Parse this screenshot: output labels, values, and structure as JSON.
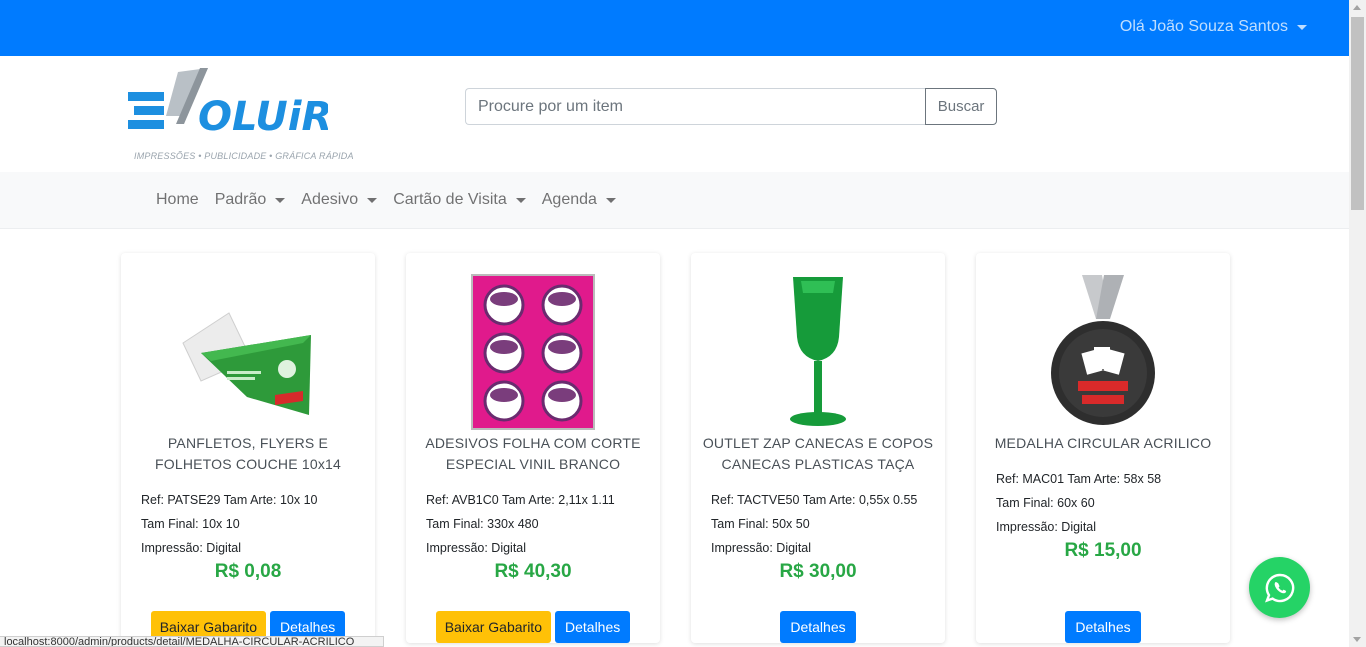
{
  "topbar": {
    "user_greeting": "Olá João Souza Santos"
  },
  "logo": {
    "tagline": "IMPRESSÕES • PUBLICIDADE • GRÁFICA RÁPIDA"
  },
  "search": {
    "placeholder": "Procure por um item",
    "button_label": "Buscar"
  },
  "nav": {
    "items": [
      {
        "label": "Home"
      },
      {
        "label": "Padrão"
      },
      {
        "label": "Adesivo"
      },
      {
        "label": "Cartão de Visita"
      },
      {
        "label": "Agenda"
      }
    ]
  },
  "products": [
    {
      "title": "PANFLETOS, FLYERS E FOLHETOS COUCHE 10x14",
      "ref_line": "Ref: PATSE29 Tam Arte: 10x 10",
      "size_line": "Tam Final: 10x 10",
      "print_line": "Impressão: Digital",
      "price": "R$ 0,08",
      "template_button": "Baixar Gabarito",
      "details_button": "Detalhes"
    },
    {
      "title": "ADESIVOS FOLHA COM CORTE ESPECIAL VINIL BRANCO",
      "ref_line": "Ref: AVB1C0 Tam Arte: 2,11x 1.11",
      "size_line": "Tam Final: 330x 480",
      "print_line": "Impressão: Digital",
      "price": "R$ 40,30",
      "template_button": "Baixar Gabarito",
      "details_button": "Detalhes"
    },
    {
      "title": "OUTLET ZAP CANECAS E COPOS CANECAS PLASTICAS TAÇA",
      "ref_line": "Ref: TACTVE50 Tam Arte: 0,55x 0.55",
      "size_line": "Tam Final: 50x 50",
      "print_line": "Impressão: Digital",
      "price": "R$ 30,00",
      "details_button": "Detalhes"
    },
    {
      "title": "MEDALHA CIRCULAR ACRILICO",
      "ref_line": "Ref: MAC01 Tam Arte: 58x 58",
      "size_line": "Tam Final: 60x 60",
      "print_line": "Impressão: Digital",
      "price": "R$ 15,00",
      "details_button": "Detalhes"
    }
  ],
  "status_bar": {
    "url": "localhost:8000/admin/products/detail/MEDALHA-CIRCULAR-ACRILICO"
  },
  "colors": {
    "primary": "#007bff",
    "warning": "#ffc107",
    "price": "#28a745",
    "whatsapp": "#25d366"
  }
}
